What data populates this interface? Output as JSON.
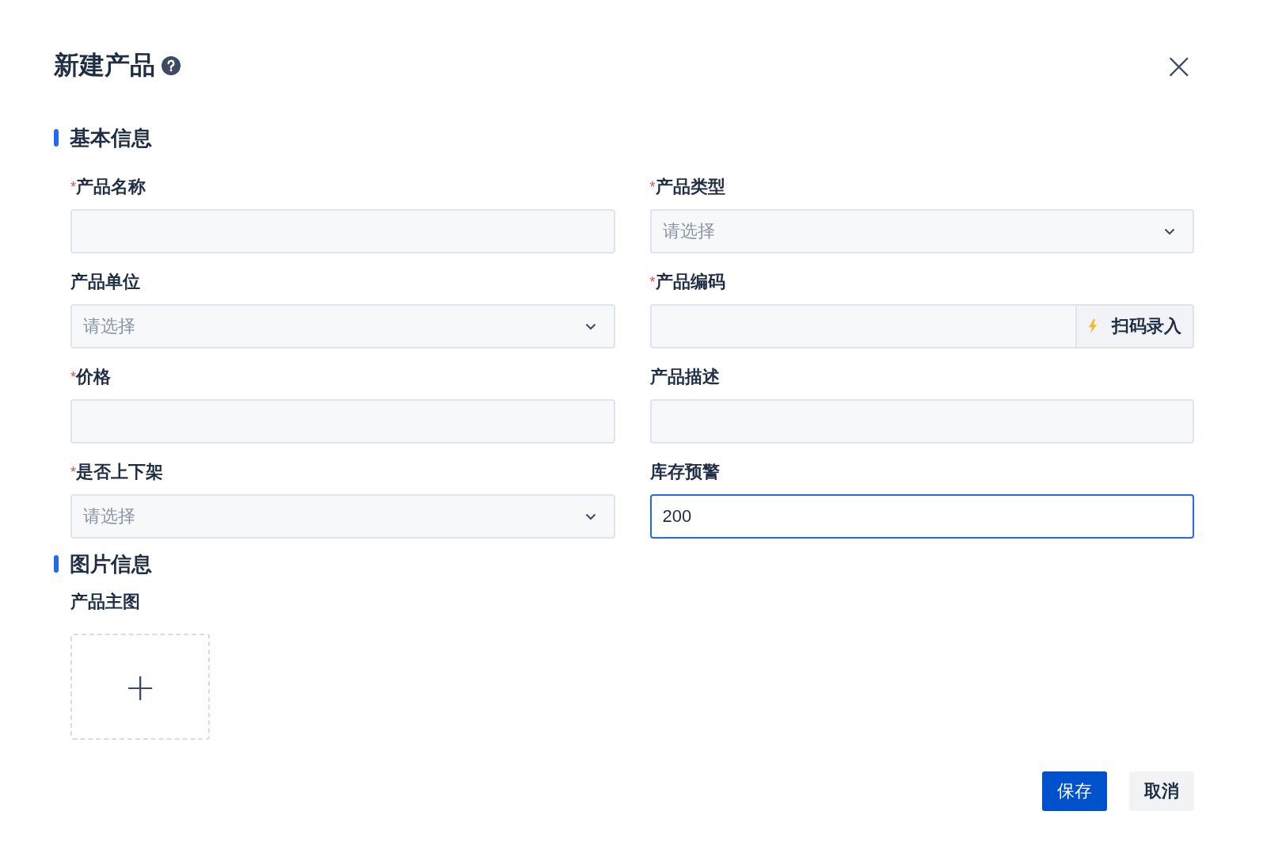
{
  "dialog": {
    "title": "新建产品",
    "close": "×"
  },
  "sections": [
    {
      "title": "基本信息",
      "fields": [
        {
          "kind": "text",
          "required_mark": "*",
          "label": "产品名称",
          "focused": false
        },
        {
          "kind": "select",
          "required_mark": "*",
          "label": "产品类型",
          "placeholder": "请选择",
          "focused": false
        },
        {
          "kind": "select",
          "label": "产品单位",
          "placeholder": "请选择",
          "focused": false
        },
        {
          "kind": "scan",
          "required_mark": "*",
          "label": "产品编码",
          "button": "扫码录入",
          "focused": false
        },
        {
          "kind": "text",
          "required_mark": "*",
          "label": "价格",
          "focused": false
        },
        {
          "kind": "text",
          "label": "产品描述",
          "focused": false
        },
        {
          "kind": "select",
          "required_mark": "*",
          "label": "是否上下架",
          "placeholder": "请选择",
          "focused": false
        },
        {
          "kind": "text",
          "label": "库存预警",
          "value": "200",
          "focused": true
        }
      ]
    },
    {
      "title": "图片信息",
      "fields": [
        {
          "kind": "upload",
          "label": "产品主图",
          "button": "+"
        }
      ]
    }
  ],
  "buttons": [
    {
      "label": "保存",
      "kind": "primary"
    },
    {
      "label": "取消",
      "kind": "secondary"
    }
  ]
}
